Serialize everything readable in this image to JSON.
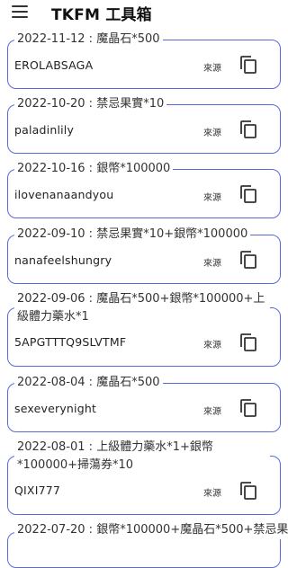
{
  "app": {
    "title": "TKFM 工具箱",
    "accent": "#5a6bd6"
  },
  "cards": [
    {
      "title": "2022-11-12 : 魔晶石*500",
      "code": "EROLABSAGA",
      "source_label": "來源"
    },
    {
      "title": "2022-10-20 : 禁忌果實*10",
      "code": "paladinlily",
      "source_label": "來源"
    },
    {
      "title": "2022-10-16 : 銀幣*100000",
      "code": "ilovenanaandyou",
      "source_label": "來源"
    },
    {
      "title": "2022-09-10 : 禁忌果實*10+銀幣*100000",
      "code": "nanafeelshungry",
      "source_label": "來源"
    },
    {
      "title": "2022-09-06 : 魔晶石*500+銀幣*100000+上級體力藥水*1",
      "code": "5APGTTTQ9SLVTMF",
      "source_label": "來源"
    },
    {
      "title": "2022-08-04 : 魔晶石*500",
      "code": "sexeverynight",
      "source_label": "來源"
    },
    {
      "title": "2022-08-01 : 上級體力藥水*1+銀幣*100000+掃蕩券*10",
      "code": "QIXI777",
      "source_label": "來源"
    },
    {
      "title": "2022-07-20 : 銀幣*100000+魔晶石*500+禁忌果"
    }
  ],
  "icons": {
    "menu": "hamburger-menu-icon",
    "copy": "copy-icon"
  }
}
